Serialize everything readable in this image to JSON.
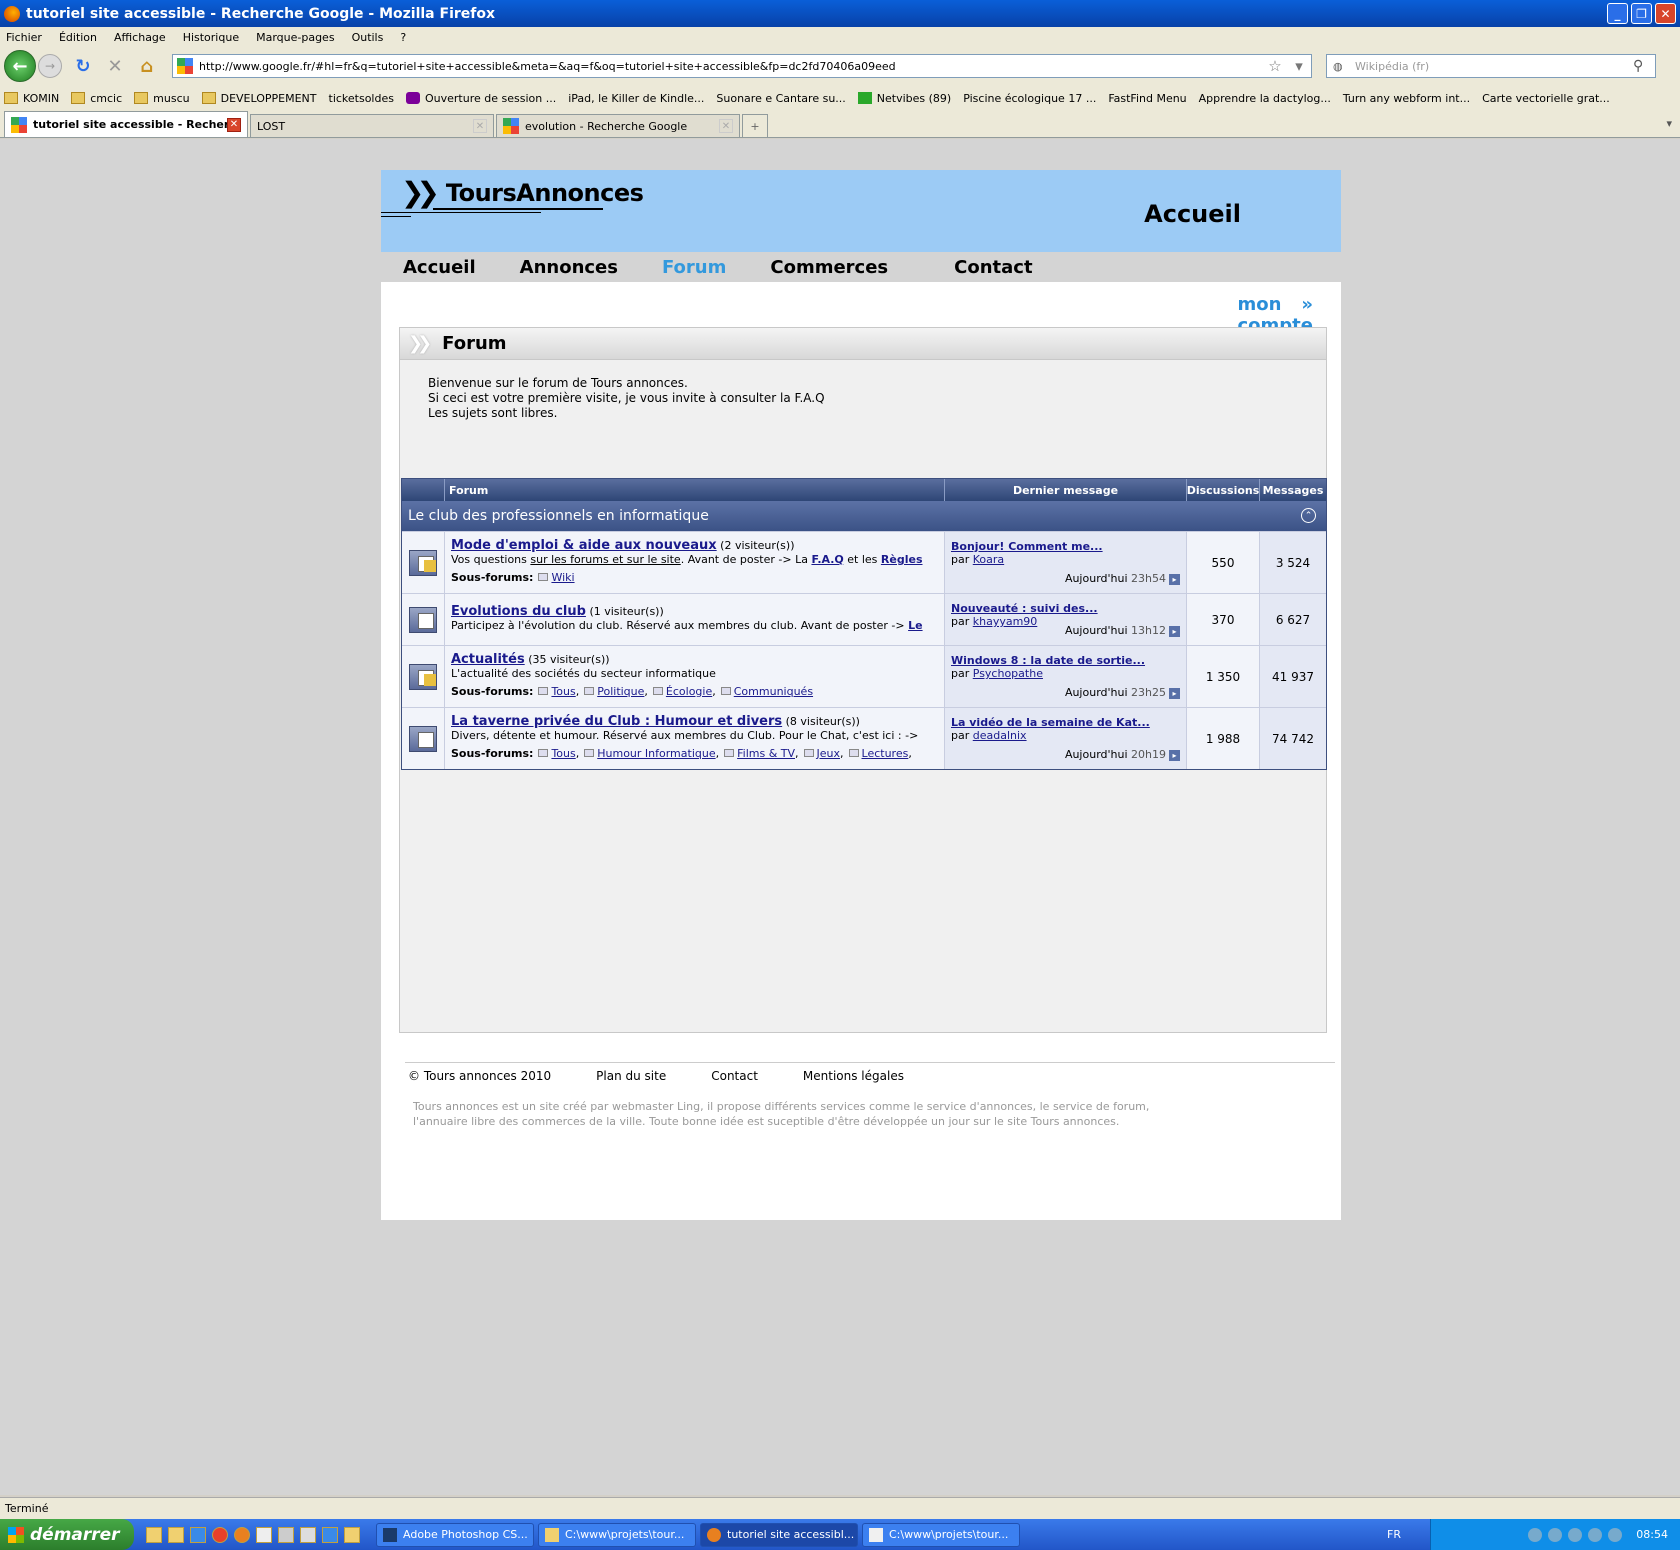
{
  "window": {
    "title": "tutoriel site accessible - Recherche Google - Mozilla Firefox"
  },
  "menu": [
    "Fichier",
    "Édition",
    "Affichage",
    "Historique",
    "Marque-pages",
    "Outils",
    "?"
  ],
  "nav": {
    "url": "http://www.google.fr/#hl=fr&q=tutoriel+site+accessible&meta=&aq=f&oq=tutoriel+site+accessible&fp=dc2fd70406a09eed",
    "search_placeholder": "Wikipédia (fr)"
  },
  "bookmarks": [
    {
      "label": "KOMIN",
      "icon": "folder"
    },
    {
      "label": "cmcic",
      "icon": "folder"
    },
    {
      "label": "muscu",
      "icon": "folder"
    },
    {
      "label": "DEVELOPPEMENT",
      "icon": "folder"
    },
    {
      "label": "ticketsoldes",
      "icon": "page"
    },
    {
      "label": "Ouverture de session ...",
      "icon": "yahoo"
    },
    {
      "label": "iPad, le Killer de Kindle...",
      "icon": "page"
    },
    {
      "label": "Suonare e Cantare su...",
      "icon": "page"
    },
    {
      "label": "Netvibes (89)",
      "icon": "plus"
    },
    {
      "label": "Piscine écologique 17 ...",
      "icon": "page"
    },
    {
      "label": "FastFind Menu",
      "icon": "page"
    },
    {
      "label": "Apprendre la dactylog...",
      "icon": "page"
    },
    {
      "label": "Turn any webform int...",
      "icon": "page"
    },
    {
      "label": "Carte vectorielle grat...",
      "icon": "page"
    }
  ],
  "tabs": [
    {
      "label": "tutoriel site accessible - Recherc...",
      "active": true
    },
    {
      "label": "LOST",
      "active": false
    },
    {
      "label": "evolution - Recherche Google",
      "active": false
    }
  ],
  "site": {
    "logo": "ToursAnnonces",
    "header_title": "Accueil",
    "nav": [
      "Accueil",
      "Annonces",
      "Forum",
      "Commerces",
      "Contact"
    ],
    "account": "mon compte",
    "box_title": "Forum",
    "intro": [
      "Bienvenue sur le forum de Tours annonces.",
      "Si ceci est votre première visite, je vous invite à consulter la F.A.Q",
      "Les sujets sont libres."
    ]
  },
  "forum": {
    "headers": {
      "forum": "Forum",
      "last": "Dernier message",
      "discussions": "Discussions",
      "messages": "Messages"
    },
    "category": "Le club des professionnels en informatique",
    "subforums_label": "Sous-forums",
    "rows": [
      {
        "name": "Mode d'emploi & aide aux nouveaux",
        "visitors": "(2 visiteur(s))",
        "desc_a": "Vos questions ",
        "desc_link": "sur les forums et sur le site",
        "desc_b": ". Avant de poster -> La ",
        "desc_link2": "F.A.Q",
        "desc_c": " et les ",
        "desc_link3": "Règles",
        "subforums": [
          "Wiki"
        ],
        "last_title": "Bonjour! Comment me...",
        "last_by": "par",
        "last_user": "Koara",
        "last_day": "Aujourd'hui",
        "last_time": "23h54",
        "discussions": "550",
        "messages": "3 524",
        "icon": "yellow"
      },
      {
        "name": "Evolutions du club",
        "visitors": "(1 visiteur(s))",
        "desc_a": "Participez à l'évolution du club. Réservé aux membres du club. Avant de poster -> ",
        "desc_link": "Le",
        "subforums": [],
        "last_title": "Nouveauté : suivi des...",
        "last_by": "par",
        "last_user": "khayyam90",
        "last_day": "Aujourd'hui",
        "last_time": "13h12",
        "discussions": "370",
        "messages": "6 627",
        "icon": "plain"
      },
      {
        "name": "Actualités",
        "visitors": "(35 visiteur(s))",
        "desc_a": "L'actualité des sociétés du secteur informatique",
        "subforums": [
          "Tous",
          "Politique",
          "Écologie",
          "Communiqués"
        ],
        "last_title": "Windows 8 : la date de sortie...",
        "last_by": "par",
        "last_user": "Psychopathe",
        "last_day": "Aujourd'hui",
        "last_time": "23h25",
        "discussions": "1 350",
        "messages": "41 937",
        "icon": "yellow"
      },
      {
        "name": "La taverne privée du Club : Humour et divers",
        "visitors": "(8 visiteur(s))",
        "desc_a": "Divers, détente et humour. Réservé aux membres du Club. Pour le Chat, c'est ici : ->",
        "subforums": [
          "Tous",
          "Humour Informatique",
          "Films & TV",
          "Jeux",
          "Lectures"
        ],
        "last_title": "La vidéo de la semaine de Kat...",
        "last_by": "par",
        "last_user": "deadalnix",
        "last_day": "Aujourd'hui",
        "last_time": "20h19",
        "discussions": "1 988",
        "messages": "74 742",
        "icon": "plain"
      }
    ]
  },
  "footer": {
    "links": [
      "© Tours annonces 2010",
      "Plan du site",
      "Contact",
      "Mentions légales"
    ],
    "desc1": "Tours annonces est un site créé par webmaster Ling, il propose différents services comme le service d'annonces, le service de forum,",
    "desc2": "l'annuaire libre des commerces de la ville. Toute bonne idée est suceptible d'être développée un jour sur le site Tours annonces."
  },
  "status": "Terminé",
  "taskbar": {
    "start": "démarrer",
    "tasks": [
      {
        "label": "Adobe Photoshop CS...",
        "active": false
      },
      {
        "label": "C:\\www\\projets\\tour...",
        "active": false
      },
      {
        "label": "tutoriel site accessibl...",
        "active": true
      },
      {
        "label": "C:\\www\\projets\\tour...",
        "active": false
      }
    ],
    "lang": "FR",
    "clock": "08:54"
  }
}
